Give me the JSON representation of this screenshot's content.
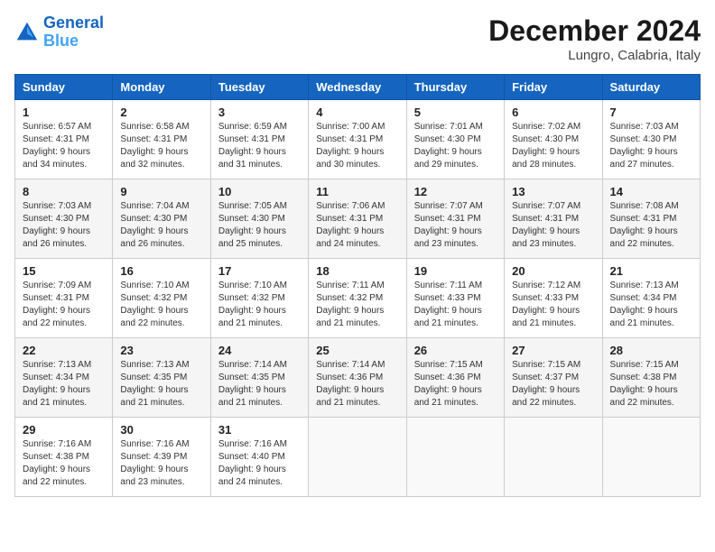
{
  "header": {
    "logo_line1": "General",
    "logo_line2": "Blue",
    "month_title": "December 2024",
    "location": "Lungro, Calabria, Italy"
  },
  "weekdays": [
    "Sunday",
    "Monday",
    "Tuesday",
    "Wednesday",
    "Thursday",
    "Friday",
    "Saturday"
  ],
  "weeks": [
    [
      {
        "day": "1",
        "sunrise": "6:57 AM",
        "sunset": "4:31 PM",
        "daylight": "9 hours and 34 minutes."
      },
      {
        "day": "2",
        "sunrise": "6:58 AM",
        "sunset": "4:31 PM",
        "daylight": "9 hours and 32 minutes."
      },
      {
        "day": "3",
        "sunrise": "6:59 AM",
        "sunset": "4:31 PM",
        "daylight": "9 hours and 31 minutes."
      },
      {
        "day": "4",
        "sunrise": "7:00 AM",
        "sunset": "4:31 PM",
        "daylight": "9 hours and 30 minutes."
      },
      {
        "day": "5",
        "sunrise": "7:01 AM",
        "sunset": "4:30 PM",
        "daylight": "9 hours and 29 minutes."
      },
      {
        "day": "6",
        "sunrise": "7:02 AM",
        "sunset": "4:30 PM",
        "daylight": "9 hours and 28 minutes."
      },
      {
        "day": "7",
        "sunrise": "7:03 AM",
        "sunset": "4:30 PM",
        "daylight": "9 hours and 27 minutes."
      }
    ],
    [
      {
        "day": "8",
        "sunrise": "7:03 AM",
        "sunset": "4:30 PM",
        "daylight": "9 hours and 26 minutes."
      },
      {
        "day": "9",
        "sunrise": "7:04 AM",
        "sunset": "4:30 PM",
        "daylight": "9 hours and 26 minutes."
      },
      {
        "day": "10",
        "sunrise": "7:05 AM",
        "sunset": "4:30 PM",
        "daylight": "9 hours and 25 minutes."
      },
      {
        "day": "11",
        "sunrise": "7:06 AM",
        "sunset": "4:31 PM",
        "daylight": "9 hours and 24 minutes."
      },
      {
        "day": "12",
        "sunrise": "7:07 AM",
        "sunset": "4:31 PM",
        "daylight": "9 hours and 23 minutes."
      },
      {
        "day": "13",
        "sunrise": "7:07 AM",
        "sunset": "4:31 PM",
        "daylight": "9 hours and 23 minutes."
      },
      {
        "day": "14",
        "sunrise": "7:08 AM",
        "sunset": "4:31 PM",
        "daylight": "9 hours and 22 minutes."
      }
    ],
    [
      {
        "day": "15",
        "sunrise": "7:09 AM",
        "sunset": "4:31 PM",
        "daylight": "9 hours and 22 minutes."
      },
      {
        "day": "16",
        "sunrise": "7:10 AM",
        "sunset": "4:32 PM",
        "daylight": "9 hours and 22 minutes."
      },
      {
        "day": "17",
        "sunrise": "7:10 AM",
        "sunset": "4:32 PM",
        "daylight": "9 hours and 21 minutes."
      },
      {
        "day": "18",
        "sunrise": "7:11 AM",
        "sunset": "4:32 PM",
        "daylight": "9 hours and 21 minutes."
      },
      {
        "day": "19",
        "sunrise": "7:11 AM",
        "sunset": "4:33 PM",
        "daylight": "9 hours and 21 minutes."
      },
      {
        "day": "20",
        "sunrise": "7:12 AM",
        "sunset": "4:33 PM",
        "daylight": "9 hours and 21 minutes."
      },
      {
        "day": "21",
        "sunrise": "7:13 AM",
        "sunset": "4:34 PM",
        "daylight": "9 hours and 21 minutes."
      }
    ],
    [
      {
        "day": "22",
        "sunrise": "7:13 AM",
        "sunset": "4:34 PM",
        "daylight": "9 hours and 21 minutes."
      },
      {
        "day": "23",
        "sunrise": "7:13 AM",
        "sunset": "4:35 PM",
        "daylight": "9 hours and 21 minutes."
      },
      {
        "day": "24",
        "sunrise": "7:14 AM",
        "sunset": "4:35 PM",
        "daylight": "9 hours and 21 minutes."
      },
      {
        "day": "25",
        "sunrise": "7:14 AM",
        "sunset": "4:36 PM",
        "daylight": "9 hours and 21 minutes."
      },
      {
        "day": "26",
        "sunrise": "7:15 AM",
        "sunset": "4:36 PM",
        "daylight": "9 hours and 21 minutes."
      },
      {
        "day": "27",
        "sunrise": "7:15 AM",
        "sunset": "4:37 PM",
        "daylight": "9 hours and 22 minutes."
      },
      {
        "day": "28",
        "sunrise": "7:15 AM",
        "sunset": "4:38 PM",
        "daylight": "9 hours and 22 minutes."
      }
    ],
    [
      {
        "day": "29",
        "sunrise": "7:16 AM",
        "sunset": "4:38 PM",
        "daylight": "9 hours and 22 minutes."
      },
      {
        "day": "30",
        "sunrise": "7:16 AM",
        "sunset": "4:39 PM",
        "daylight": "9 hours and 23 minutes."
      },
      {
        "day": "31",
        "sunrise": "7:16 AM",
        "sunset": "4:40 PM",
        "daylight": "9 hours and 24 minutes."
      },
      null,
      null,
      null,
      null
    ]
  ]
}
